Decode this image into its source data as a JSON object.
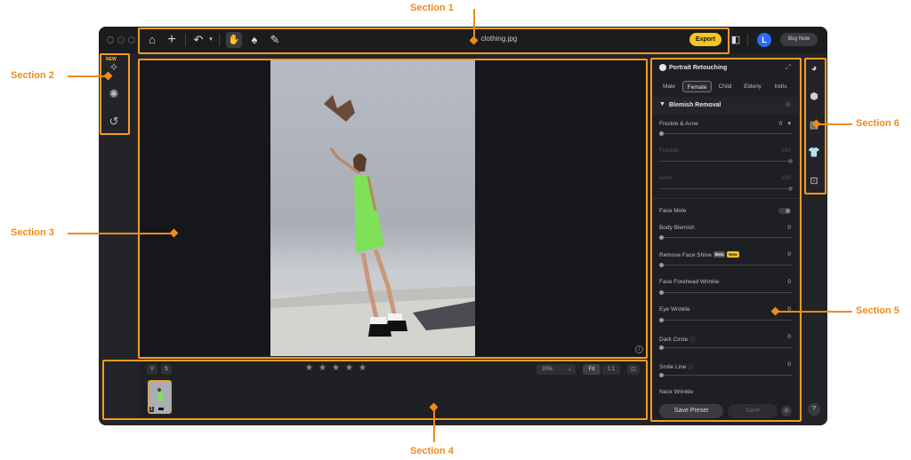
{
  "titlebar": {
    "filename": "clothing.jpg",
    "export_label": "Export",
    "avatar_initial": "L",
    "buy_now_label": "Buy Now"
  },
  "left_toolbar": {
    "new_badge": "NEW"
  },
  "film_strip": {
    "zoom_value": "20%",
    "fit_label": "Fit",
    "one_to_one_label": "1:1",
    "count_label": "1",
    "rating_stars": 5
  },
  "panel": {
    "title": "Portrait Retouching",
    "segments": [
      "Male",
      "Female",
      "Child",
      "Elderly",
      "Indiv."
    ],
    "active_segment": "Female",
    "section_title": "Blemish Removal",
    "freckle_acne": {
      "label": "Freckle & Acne",
      "value": "0"
    },
    "freckle": {
      "label": "Freckle",
      "value": "100"
    },
    "acne": {
      "label": "Acne",
      "value": "100"
    },
    "face_mole": {
      "label": "Face Mole"
    },
    "body_blemish": {
      "label": "Body Blemish",
      "value": "0"
    },
    "remove_face_shine": {
      "label": "Remove Face Shine",
      "beta": "Beta",
      "new": "New",
      "value": "0"
    },
    "face_forehead_wrinkle": {
      "label": "Face Forehead Wrinkle",
      "value": "0"
    },
    "eye_wrinkle": {
      "label": "Eye Wrinkle",
      "value": "0"
    },
    "dark_circle": {
      "label": "Dark Circle",
      "value": "0"
    },
    "smile_line": {
      "label": "Smile Line",
      "value": "0"
    },
    "neck_wrinkle": {
      "label": "Neck Wrinkle"
    },
    "save_preset_label": "Save Preset",
    "save_label": "Save"
  },
  "help_label": "?",
  "annotations": {
    "section1": "Section 1",
    "section2": "Section 2",
    "section3": "Section 3",
    "section4": "Section 4",
    "section5": "Section 5",
    "section6": "Section 6"
  },
  "colors": {
    "annotation": "#f59a23",
    "export_button": "#f7c51b",
    "avatar": "#2d6bff",
    "app_background": "#232427"
  }
}
